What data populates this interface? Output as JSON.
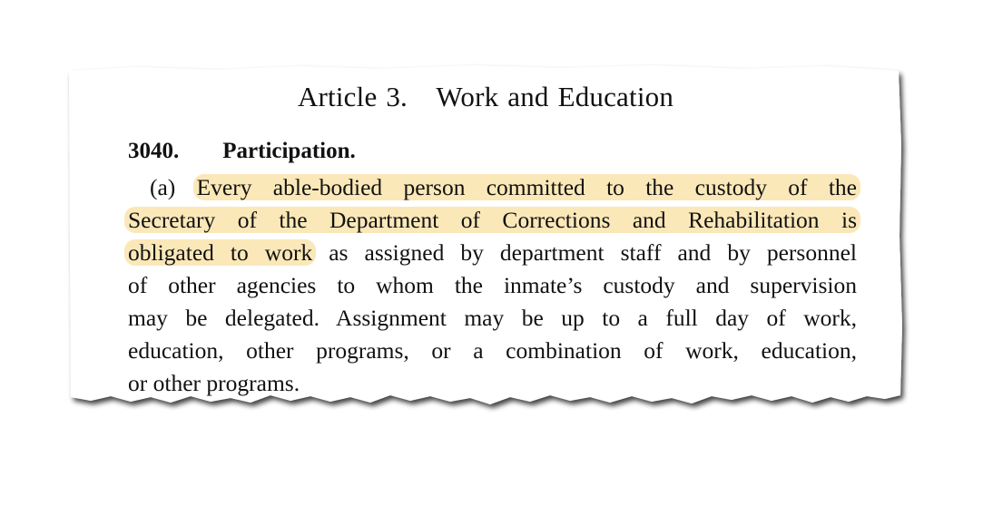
{
  "article": {
    "label": "Article",
    "number": "3.",
    "title": "Work and Education"
  },
  "section": {
    "number": "3040.",
    "title": "Participation."
  },
  "paragraph": {
    "marker": "(a)",
    "lines": [
      {
        "pre": "",
        "hl": "Every able-bodied person committed to the custody of the",
        "post": ""
      },
      {
        "pre": "",
        "hl": "Secretary of the Department of Corrections and Rehabilitation is",
        "post": ""
      },
      {
        "pre": "",
        "hl": "obligated to work",
        "post": " as assigned by department staff and by personnel"
      },
      {
        "pre": "",
        "hl": "",
        "post": "of other agencies to whom the inmate’s custody and supervision"
      },
      {
        "pre": "",
        "hl": "",
        "post": "may be delegated. Assignment may be up to a full day of work,"
      },
      {
        "pre": "",
        "hl": "",
        "post": "education, other programs, or a combination of work, education,"
      },
      {
        "pre": "",
        "hl": "",
        "post": "or other programs."
      }
    ]
  },
  "highlight_color": "#fbe8b8"
}
